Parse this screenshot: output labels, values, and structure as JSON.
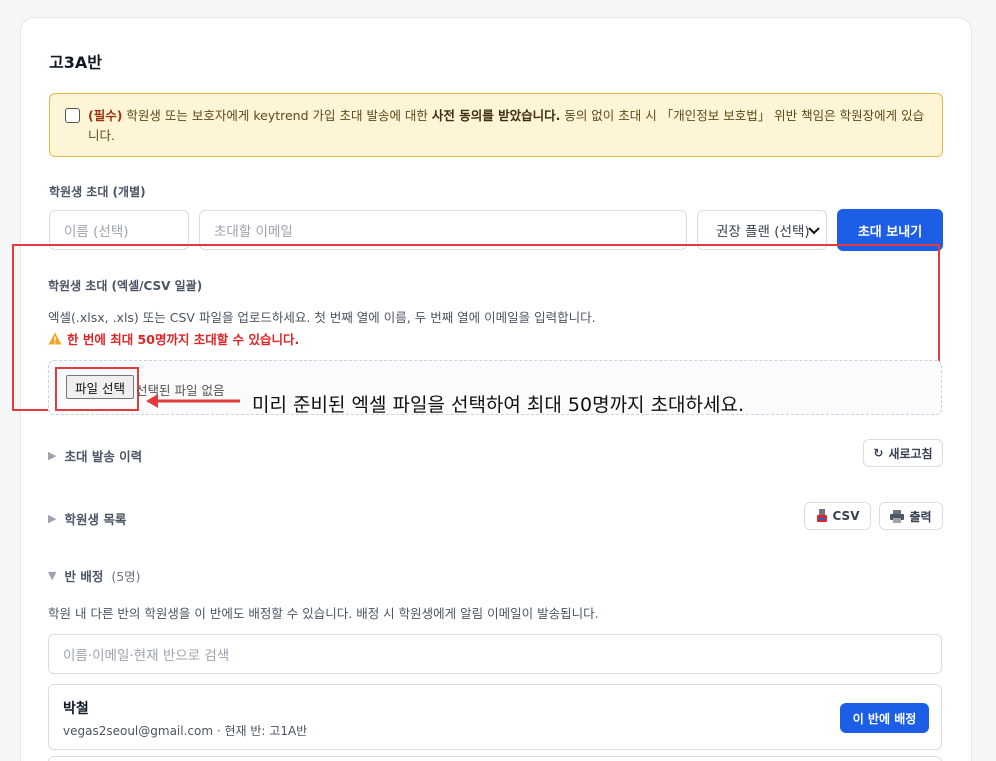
{
  "page_title": "고3A반",
  "consent": {
    "required_label": "(필수)",
    "text_before": " 학원생 또는 보호자에게 keytrend 가입 초대 발송에 대한 ",
    "bold_text": "사전 동의를 받았습니다.",
    "text_after": " 동의 없이 초대 시 「개인정보 보호법」 위반 책임은 학원장에게 있습니다."
  },
  "individual_invite": {
    "section_label": "학원생 초대 (개별)",
    "name_placeholder": "이름 (선택)",
    "email_placeholder": "초대할 이메일",
    "plan_select_value": "권장 플랜 (선택)",
    "send_button": "초대 보내기"
  },
  "bulk_invite": {
    "section_label": "학원생 초대 (엑셀/CSV 일괄)",
    "description": "엑셀(.xlsx, .xls) 또는 CSV 파일을 업로드하세요. 첫 번째 열에 이름, 두 번째 열에 이메일을 입력합니다.",
    "warning_icon": "warning-icon",
    "warning": "한 번에 최대 50명까지 초대할 수 있습니다.",
    "file_button": "파일 선택",
    "file_status": "선택된 파일 없음",
    "annotation": "미리 준비된 엑셀 파일을 선택하여 최대 50명까지 초대하세요."
  },
  "history": {
    "label": "초대 발송 이력",
    "refresh_button": "새로고침",
    "refresh_icon": "↻"
  },
  "student_list": {
    "label": "학원생 목록",
    "csv_button": "CSV",
    "print_button": "출력"
  },
  "class_assign": {
    "label": "반 배정",
    "count": "(5명)",
    "description": "학원 내 다른 반의 학원생을 이 반에도 배정할 수 있습니다. 배정 시 학원생에게 알림 이메일이 발송됩니다.",
    "search_placeholder": "이름·이메일·현재 반으로 검색",
    "students": [
      {
        "name": "박철",
        "email": "vegas2seoul@gmail.com",
        "current_class": "· 현재 반: 고1A반",
        "assign_button": "이 반에 배정"
      }
    ]
  },
  "colors": {
    "primary": "#1d5ee6",
    "warning_bg": "#fef5d6",
    "warning_border": "#e6b84a",
    "highlight": "#e23b3b",
    "danger_text": "#dc2626"
  }
}
